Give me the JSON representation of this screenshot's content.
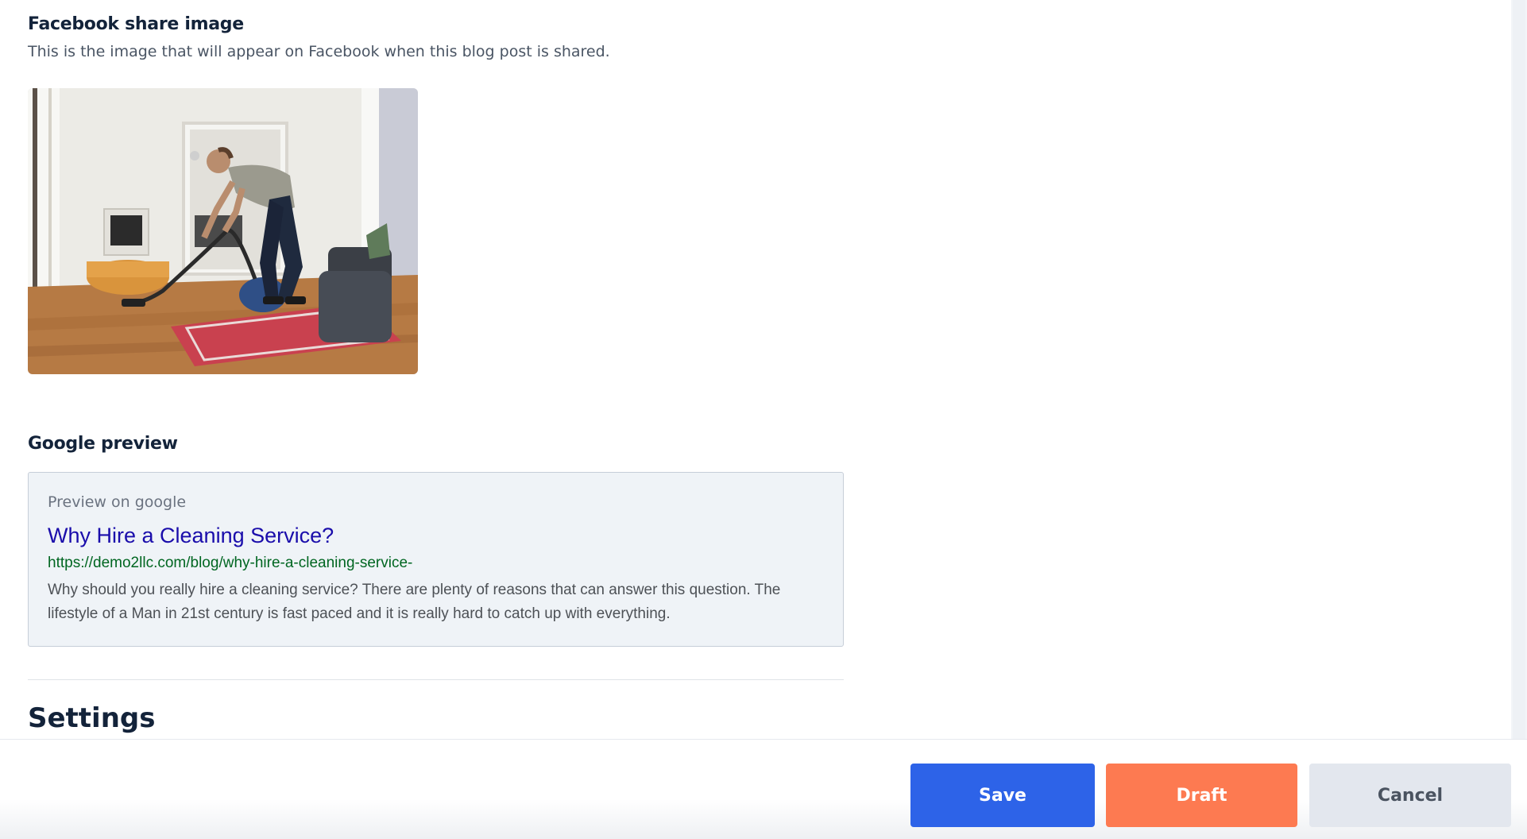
{
  "facebook": {
    "title": "Facebook share image",
    "description": "This is the image that will appear on Facebook when this blog post is shared.",
    "image_alt": "man-vacuuming-living-room-photo"
  },
  "google": {
    "title": "Google preview",
    "preview_label": "Preview on google",
    "heading": "Why Hire a Cleaning Service?",
    "url": "https://demo2llc.com/blog/why-hire-a-cleaning-service-",
    "description": "Why should you really hire a cleaning service? There are plenty of reasons that can answer this question. The lifestyle of a Man in 21st century is fast paced and it is really hard to catch up with everything."
  },
  "settings": {
    "title": "Settings"
  },
  "actions": {
    "save_label": "Save",
    "draft_label": "Draft",
    "cancel_label": "Cancel"
  },
  "colors": {
    "save": "#2d63e8",
    "draft": "#fd7a51",
    "cancel": "#e3e7ee",
    "google_link": "#1a0dab",
    "google_url": "#006621"
  }
}
